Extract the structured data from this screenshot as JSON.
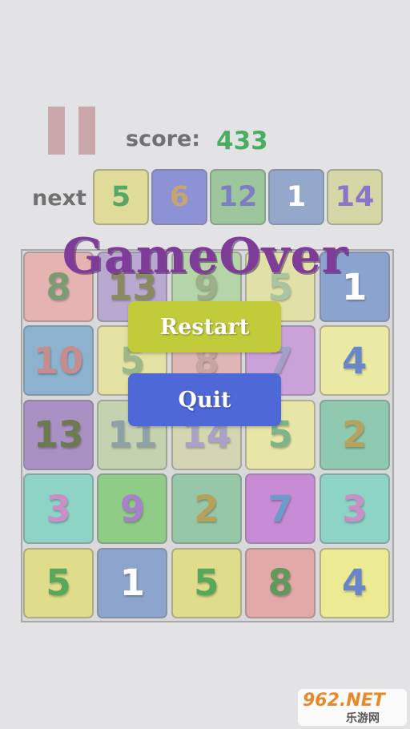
{
  "header": {
    "score_label": "score:",
    "score_value": "433",
    "next_label": "next"
  },
  "next_tiles": [
    {
      "value": "5",
      "bg": "#dedc98",
      "fg": "#56a765"
    },
    {
      "value": "6",
      "bg": "#8d91d6",
      "fg": "#c7a66c"
    },
    {
      "value": "12",
      "bg": "#9dc69c",
      "fg": "#7e7ec4"
    },
    {
      "value": "1",
      "bg": "#93a8cb",
      "fg": "#ffffff"
    },
    {
      "value": "14",
      "bg": "#d6d7a7",
      "fg": "#8a76c8"
    }
  ],
  "board": [
    [
      {
        "value": "8",
        "bg": "#e6b3b3",
        "fg": "#7a9c72"
      },
      {
        "value": "13",
        "bg": "#b9a8d0",
        "fg": "#8a8a60"
      },
      {
        "value": "9",
        "bg": "#b5d4a8",
        "fg": "#9bb086"
      },
      {
        "value": "5",
        "bg": "#e1e0a7",
        "fg": "#a9c4a0"
      },
      {
        "value": "1",
        "bg": "#8ba3cf",
        "fg": "#ffffff"
      }
    ],
    [
      {
        "value": "10",
        "bg": "#8cb2cf",
        "fg": "#c58d8d"
      },
      {
        "value": "5",
        "bg": "#e4e2a3",
        "fg": "#9ab889"
      },
      {
        "value": "8",
        "bg": "#dfb6b6",
        "fg": "#c6a6a0"
      },
      {
        "value": "7",
        "bg": "#c9a2d9",
        "fg": "#a2a0c8"
      },
      {
        "value": "4",
        "bg": "#ebeaa5",
        "fg": "#6a86c9"
      }
    ],
    [
      {
        "value": "13",
        "bg": "#a991c4",
        "fg": "#6d7a4f"
      },
      {
        "value": "11",
        "bg": "#c5d2b0",
        "fg": "#8ea1a8"
      },
      {
        "value": "14",
        "bg": "#d4d6b3",
        "fg": "#a8a2c8"
      },
      {
        "value": "5",
        "bg": "#e8e6a6",
        "fg": "#7fb48a"
      },
      {
        "value": "2",
        "bg": "#8ec9b0",
        "fg": "#b5a35f"
      }
    ],
    [
      {
        "value": "3",
        "bg": "#8dd4c7",
        "fg": "#c98fc6"
      },
      {
        "value": "9",
        "bg": "#8fcc86",
        "fg": "#a882c9"
      },
      {
        "value": "2",
        "bg": "#96c8a8",
        "fg": "#b7a057"
      },
      {
        "value": "7",
        "bg": "#c88bd6",
        "fg": "#6f9bcb"
      },
      {
        "value": "3",
        "bg": "#8dd4c7",
        "fg": "#c98fc6"
      }
    ],
    [
      {
        "value": "5",
        "bg": "#dfdd8c",
        "fg": "#58a85c"
      },
      {
        "value": "1",
        "bg": "#8da4cd",
        "fg": "#ffffff"
      },
      {
        "value": "5",
        "bg": "#dfdd8c",
        "fg": "#58a85c"
      },
      {
        "value": "8",
        "bg": "#e3a8a8",
        "fg": "#5f9a5c"
      },
      {
        "value": "4",
        "bg": "#eceb94",
        "fg": "#6a86c9"
      }
    ]
  ],
  "overlay": {
    "title": "GameOver",
    "restart_label": "Restart",
    "quit_label": "Quit"
  },
  "watermark": {
    "main": "962.NET",
    "sub": "乐游网"
  }
}
